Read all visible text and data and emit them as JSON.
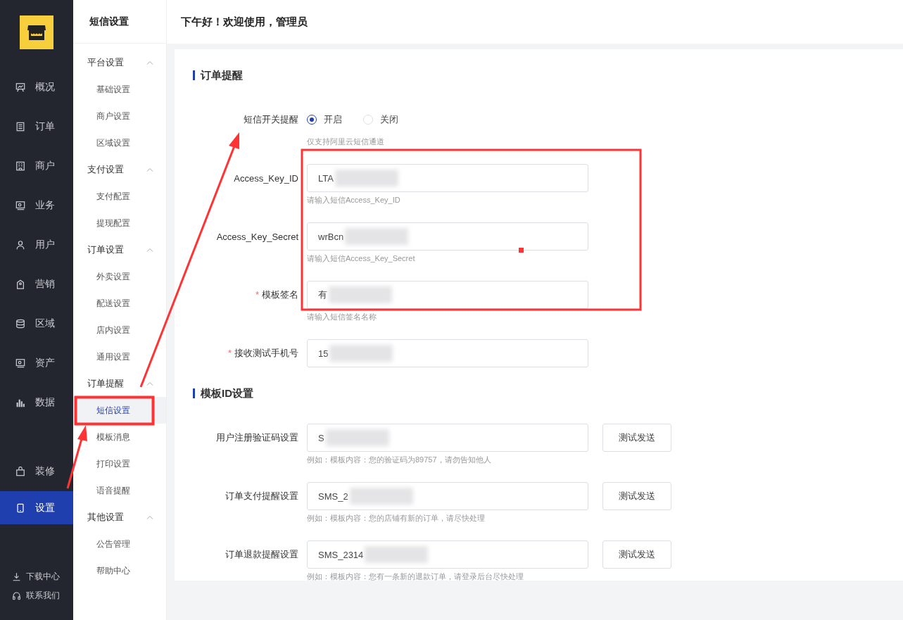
{
  "sidebar": {
    "items": [
      {
        "label": "概况",
        "selected": false
      },
      {
        "label": "订单",
        "selected": false
      },
      {
        "label": "商户",
        "selected": false
      },
      {
        "label": "业务",
        "selected": false
      },
      {
        "label": "用户",
        "selected": false
      },
      {
        "label": "营销",
        "selected": false
      },
      {
        "label": "区域",
        "selected": false
      },
      {
        "label": "资产",
        "selected": false
      },
      {
        "label": "数据",
        "selected": false
      },
      {
        "label": "装修",
        "selected": false
      },
      {
        "label": "设置",
        "selected": true
      }
    ],
    "footer": [
      {
        "label": "下载中心"
      },
      {
        "label": "联系我们"
      }
    ]
  },
  "submenu": {
    "title": "短信设置",
    "groups": [
      {
        "label": "平台设置",
        "expanded": true,
        "children": [
          {
            "label": "基础设置",
            "selected": false
          },
          {
            "label": "商户设置",
            "selected": false
          },
          {
            "label": "区域设置",
            "selected": false
          }
        ]
      },
      {
        "label": "支付设置",
        "expanded": true,
        "children": [
          {
            "label": "支付配置",
            "selected": false
          },
          {
            "label": "提现配置",
            "selected": false
          }
        ]
      },
      {
        "label": "订单设置",
        "expanded": true,
        "children": [
          {
            "label": "外卖设置",
            "selected": false
          },
          {
            "label": "配送设置",
            "selected": false
          },
          {
            "label": "店内设置",
            "selected": false
          },
          {
            "label": "通用设置",
            "selected": false
          }
        ]
      },
      {
        "label": "订单提醒",
        "expanded": true,
        "children": [
          {
            "label": "短信设置",
            "selected": true
          },
          {
            "label": "模板消息",
            "selected": false
          },
          {
            "label": "打印设置",
            "selected": false
          },
          {
            "label": "语音提醒",
            "selected": false
          }
        ]
      },
      {
        "label": "其他设置",
        "expanded": true,
        "children": [
          {
            "label": "公告管理",
            "selected": false
          },
          {
            "label": "帮助中心",
            "selected": false
          }
        ]
      }
    ]
  },
  "header": {
    "greeting": "下午好！欢迎使用，管理员"
  },
  "sections": [
    {
      "title": "订单提醒",
      "fields": [
        {
          "kind": "radio",
          "label": "短信开关提醒",
          "options": [
            {
              "label": "开启",
              "selected": true
            },
            {
              "label": "关闭",
              "selected": false
            }
          ],
          "hint": "仅支持阿里云短信通道"
        },
        {
          "kind": "input",
          "label": "Access_Key_ID",
          "value": "LTA",
          "redacted": true,
          "hint": "请输入短信Access_Key_ID"
        },
        {
          "kind": "input",
          "label": "Access_Key_Secret",
          "value": "wrBcn",
          "redacted": true,
          "hint": "请输入短信Access_Key_Secret"
        },
        {
          "kind": "input",
          "required_mark": "*",
          "label": "模板签名",
          "value": "有",
          "redacted": true,
          "hint": "请输入短信签名名称"
        },
        {
          "kind": "input",
          "required_mark": "*",
          "label": "接收测试手机号",
          "value": "15",
          "redacted": true
        }
      ]
    },
    {
      "title": "模板ID设置",
      "fields": [
        {
          "kind": "input",
          "label": "用户注册验证码设置",
          "value": "S",
          "redacted": true,
          "button": "测试发送",
          "hint": "例如：模板内容：您的验证码为89757，请勿告知他人"
        },
        {
          "kind": "input",
          "label": "订单支付提醒设置",
          "value": "SMS_2",
          "redacted": true,
          "button": "测试发送",
          "hint": "例如：模板内容：您的店铺有新的订单，请尽快处理"
        },
        {
          "kind": "input",
          "label": "订单退款提醒设置",
          "value": "SMS_2314",
          "redacted": true,
          "button": "测试发送",
          "hint": "例如：模板内容：您有一条新的退款订单，请登录后台尽快处理"
        }
      ]
    }
  ]
}
